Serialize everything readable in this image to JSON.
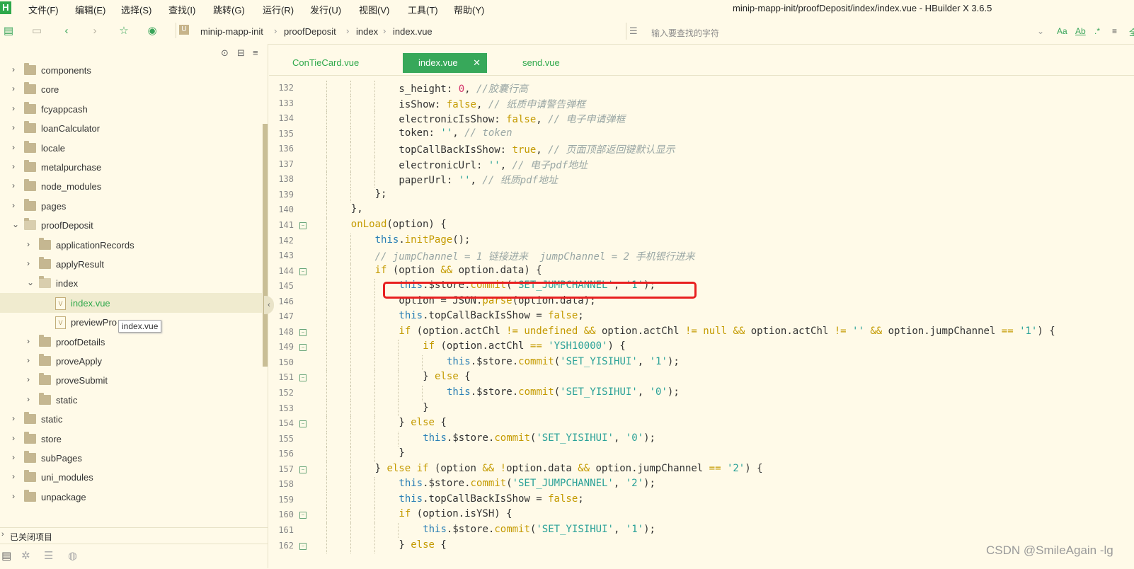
{
  "app": {
    "logo": "H",
    "window_title": "minip-mapp-init/proofDeposit/index/index.vue - HBuilder X 3.6.5",
    "menu": [
      "文件(F)",
      "编辑(E)",
      "选择(S)",
      "查找(I)",
      "跳转(G)",
      "运行(R)",
      "发行(U)",
      "视图(V)",
      "工具(T)",
      "帮助(Y)"
    ]
  },
  "toolbar": {
    "breadcrumb_icon": "U",
    "breadcrumb": [
      "minip-mapp-init",
      "proofDeposit",
      "index",
      "index.vue"
    ],
    "search_placeholder": "输入要查找的字符",
    "search_options": [
      "Aa",
      "Ab",
      ".*"
    ]
  },
  "sidebar": {
    "tree": [
      {
        "label": "components",
        "type": "folder",
        "depth": 0,
        "expanded": false
      },
      {
        "label": "core",
        "type": "folder",
        "depth": 0,
        "expanded": false
      },
      {
        "label": "fcyappcash",
        "type": "folder",
        "depth": 0,
        "expanded": false
      },
      {
        "label": "loanCalculator",
        "type": "folder",
        "depth": 0,
        "expanded": false
      },
      {
        "label": "locale",
        "type": "folder",
        "depth": 0,
        "expanded": false
      },
      {
        "label": "metalpurchase",
        "type": "folder",
        "depth": 0,
        "expanded": false
      },
      {
        "label": "node_modules",
        "type": "folder",
        "depth": 0,
        "expanded": false
      },
      {
        "label": "pages",
        "type": "folder",
        "depth": 0,
        "expanded": false
      },
      {
        "label": "proofDeposit",
        "type": "folder",
        "depth": 0,
        "expanded": true
      },
      {
        "label": "applicationRecords",
        "type": "folder",
        "depth": 1,
        "expanded": false
      },
      {
        "label": "applyResult",
        "type": "folder",
        "depth": 1,
        "expanded": false
      },
      {
        "label": "index",
        "type": "folder",
        "depth": 1,
        "expanded": true
      },
      {
        "label": "index.vue",
        "type": "file",
        "depth": 2,
        "selected": true
      },
      {
        "label": "previewPro",
        "type": "file",
        "depth": 2
      },
      {
        "label": "proofDetails",
        "type": "folder",
        "depth": 1,
        "expanded": false
      },
      {
        "label": "proveApply",
        "type": "folder",
        "depth": 1,
        "expanded": false
      },
      {
        "label": "proveSubmit",
        "type": "folder",
        "depth": 1,
        "expanded": false
      },
      {
        "label": "static",
        "type": "folder",
        "depth": 1,
        "expanded": false
      },
      {
        "label": "static",
        "type": "folder",
        "depth": 0,
        "expanded": false
      },
      {
        "label": "store",
        "type": "folder",
        "depth": 0,
        "expanded": false
      },
      {
        "label": "subPages",
        "type": "folder",
        "depth": 0,
        "expanded": false
      },
      {
        "label": "uni_modules",
        "type": "folder",
        "depth": 0,
        "expanded": false
      },
      {
        "label": "unpackage",
        "type": "folder",
        "depth": 0,
        "expanded": false
      }
    ],
    "tooltip": "index.vue",
    "closed_projects": "已关闭项目",
    "file_icon_letter": "V"
  },
  "editor": {
    "tabs": [
      {
        "label": "ConTieCard.vue",
        "active": false
      },
      {
        "label": "index.vue",
        "active": true
      },
      {
        "label": "send.vue",
        "active": false
      }
    ],
    "lines": [
      {
        "n": "132",
        "fold": false,
        "indent": 4,
        "segs": [
          [
            "",
            "s_height: "
          ],
          [
            "num",
            "0"
          ],
          [
            "",
            ", "
          ],
          [
            "cm",
            "//胶囊行高"
          ]
        ]
      },
      {
        "n": "133",
        "fold": false,
        "indent": 4,
        "segs": [
          [
            "",
            "isShow: "
          ],
          [
            "kw",
            "false"
          ],
          [
            "",
            ", "
          ],
          [
            "cm",
            "// 纸质申请警告弹框"
          ]
        ]
      },
      {
        "n": "134",
        "fold": false,
        "indent": 4,
        "segs": [
          [
            "",
            "electronicIsShow: "
          ],
          [
            "kw",
            "false"
          ],
          [
            "",
            ", "
          ],
          [
            "cm",
            "// 电子申请弹框"
          ]
        ]
      },
      {
        "n": "135",
        "fold": false,
        "indent": 4,
        "segs": [
          [
            "",
            "token: "
          ],
          [
            "str",
            "''"
          ],
          [
            "",
            ", "
          ],
          [
            "cm",
            "// token"
          ]
        ]
      },
      {
        "n": "136",
        "fold": false,
        "indent": 4,
        "segs": [
          [
            "",
            "topCallBackIsShow: "
          ],
          [
            "kw",
            "true"
          ],
          [
            "",
            ", "
          ],
          [
            "cm",
            "// 页面顶部返回键默认显示"
          ]
        ]
      },
      {
        "n": "137",
        "fold": false,
        "indent": 4,
        "segs": [
          [
            "",
            "electronicUrl: "
          ],
          [
            "str",
            "''"
          ],
          [
            "",
            ", "
          ],
          [
            "cm",
            "// 电子pdf地址"
          ]
        ]
      },
      {
        "n": "138",
        "fold": false,
        "indent": 4,
        "segs": [
          [
            "",
            "paperUrl: "
          ],
          [
            "str",
            "''"
          ],
          [
            "",
            ", "
          ],
          [
            "cm",
            "// 纸质pdf地址"
          ]
        ]
      },
      {
        "n": "139",
        "fold": false,
        "indent": 3,
        "segs": [
          [
            "",
            "};"
          ]
        ]
      },
      {
        "n": "140",
        "fold": false,
        "indent": 2,
        "segs": [
          [
            "",
            "},"
          ]
        ]
      },
      {
        "n": "141",
        "fold": true,
        "indent": 2,
        "segs": [
          [
            "fn",
            "onLoad"
          ],
          [
            "",
            "(option) {"
          ]
        ]
      },
      {
        "n": "142",
        "fold": false,
        "indent": 3,
        "segs": [
          [
            "this",
            "this"
          ],
          [
            "",
            "."
          ],
          [
            "fn",
            "initPage"
          ],
          [
            "",
            "();"
          ]
        ]
      },
      {
        "n": "143",
        "fold": false,
        "indent": 3,
        "segs": [
          [
            "cm",
            "// jumpChannel = 1 链接进来  jumpChannel = 2 手机银行进来"
          ]
        ]
      },
      {
        "n": "144",
        "fold": true,
        "indent": 3,
        "segs": [
          [
            "kw",
            "if"
          ],
          [
            "",
            " (option "
          ],
          [
            "kw",
            "&&"
          ],
          [
            "",
            " option.data) {"
          ]
        ]
      },
      {
        "n": "145",
        "fold": false,
        "indent": 4,
        "segs": [
          [
            "this",
            "this"
          ],
          [
            "",
            ".$store."
          ],
          [
            "fn",
            "commit"
          ],
          [
            "",
            "("
          ],
          [
            "str",
            "'SET_JUMPCHANNEL'"
          ],
          [
            "",
            ", "
          ],
          [
            "str",
            "'1'"
          ],
          [
            "",
            ");"
          ]
        ]
      },
      {
        "n": "146",
        "fold": false,
        "indent": 4,
        "segs": [
          [
            "",
            "option = JSON."
          ],
          [
            "fn",
            "parse"
          ],
          [
            "",
            "(option.data);"
          ]
        ]
      },
      {
        "n": "147",
        "fold": false,
        "indent": 4,
        "segs": [
          [
            "this",
            "this"
          ],
          [
            "",
            ".topCallBackIsShow = "
          ],
          [
            "kw",
            "false"
          ],
          [
            "",
            ";"
          ]
        ]
      },
      {
        "n": "148",
        "fold": true,
        "indent": 4,
        "segs": [
          [
            "kw",
            "if"
          ],
          [
            "",
            " (option.actChl "
          ],
          [
            "kw",
            "!="
          ],
          [
            "",
            " "
          ],
          [
            "kw",
            "undefined"
          ],
          [
            "",
            " "
          ],
          [
            "kw",
            "&&"
          ],
          [
            "",
            " option.actChl "
          ],
          [
            "kw",
            "!="
          ],
          [
            "",
            " "
          ],
          [
            "kw",
            "null"
          ],
          [
            "",
            " "
          ],
          [
            "kw",
            "&&"
          ],
          [
            "",
            " option.actChl "
          ],
          [
            "kw",
            "!="
          ],
          [
            "",
            " "
          ],
          [
            "str",
            "''"
          ],
          [
            "",
            " "
          ],
          [
            "kw",
            "&&"
          ],
          [
            "",
            " option.jumpChannel "
          ],
          [
            "kw",
            "=="
          ],
          [
            "",
            " "
          ],
          [
            "str",
            "'1'"
          ],
          [
            "",
            ") {"
          ]
        ]
      },
      {
        "n": "149",
        "fold": true,
        "indent": 5,
        "segs": [
          [
            "kw",
            "if"
          ],
          [
            "",
            " (option.actChl "
          ],
          [
            "kw",
            "=="
          ],
          [
            "",
            " "
          ],
          [
            "str",
            "'YSH10000'"
          ],
          [
            "",
            ") {"
          ]
        ]
      },
      {
        "n": "150",
        "fold": false,
        "indent": 6,
        "segs": [
          [
            "this",
            "this"
          ],
          [
            "",
            ".$store."
          ],
          [
            "fn",
            "commit"
          ],
          [
            "",
            "("
          ],
          [
            "str",
            "'SET_YISIHUI'"
          ],
          [
            "",
            ", "
          ],
          [
            "str",
            "'1'"
          ],
          [
            "",
            ");"
          ]
        ]
      },
      {
        "n": "151",
        "fold": true,
        "indent": 5,
        "segs": [
          [
            "",
            "} "
          ],
          [
            "kw",
            "else"
          ],
          [
            "",
            " {"
          ]
        ]
      },
      {
        "n": "152",
        "fold": false,
        "indent": 6,
        "segs": [
          [
            "this",
            "this"
          ],
          [
            "",
            ".$store."
          ],
          [
            "fn",
            "commit"
          ],
          [
            "",
            "("
          ],
          [
            "str",
            "'SET_YISIHUI'"
          ],
          [
            "",
            ", "
          ],
          [
            "str",
            "'0'"
          ],
          [
            "",
            ");"
          ]
        ]
      },
      {
        "n": "153",
        "fold": false,
        "indent": 5,
        "segs": [
          [
            "",
            "}"
          ]
        ]
      },
      {
        "n": "154",
        "fold": true,
        "indent": 4,
        "segs": [
          [
            "",
            "} "
          ],
          [
            "kw",
            "else"
          ],
          [
            "",
            " {"
          ]
        ]
      },
      {
        "n": "155",
        "fold": false,
        "indent": 5,
        "segs": [
          [
            "this",
            "this"
          ],
          [
            "",
            ".$store."
          ],
          [
            "fn",
            "commit"
          ],
          [
            "",
            "("
          ],
          [
            "str",
            "'SET_YISIHUI'"
          ],
          [
            "",
            ", "
          ],
          [
            "str",
            "'0'"
          ],
          [
            "",
            ");"
          ]
        ]
      },
      {
        "n": "156",
        "fold": false,
        "indent": 4,
        "segs": [
          [
            "",
            "}"
          ]
        ]
      },
      {
        "n": "157",
        "fold": true,
        "indent": 3,
        "segs": [
          [
            "",
            "} "
          ],
          [
            "kw",
            "else if"
          ],
          [
            "",
            " (option "
          ],
          [
            "kw",
            "&&"
          ],
          [
            "",
            " "
          ],
          [
            "kw",
            "!"
          ],
          [
            "",
            "option.data "
          ],
          [
            "kw",
            "&&"
          ],
          [
            "",
            " option.jumpChannel "
          ],
          [
            "kw",
            "=="
          ],
          [
            "",
            " "
          ],
          [
            "str",
            "'2'"
          ],
          [
            "",
            ") {"
          ]
        ]
      },
      {
        "n": "158",
        "fold": false,
        "indent": 4,
        "segs": [
          [
            "this",
            "this"
          ],
          [
            "",
            ".$store."
          ],
          [
            "fn",
            "commit"
          ],
          [
            "",
            "("
          ],
          [
            "str",
            "'SET_JUMPCHANNEL'"
          ],
          [
            "",
            ", "
          ],
          [
            "str",
            "'2'"
          ],
          [
            "",
            ");"
          ]
        ]
      },
      {
        "n": "159",
        "fold": false,
        "indent": 4,
        "segs": [
          [
            "this",
            "this"
          ],
          [
            "",
            ".topCallBackIsShow = "
          ],
          [
            "kw",
            "false"
          ],
          [
            "",
            ";"
          ]
        ]
      },
      {
        "n": "160",
        "fold": true,
        "indent": 4,
        "segs": [
          [
            "kw",
            "if"
          ],
          [
            "",
            " (option.isYSH) {"
          ]
        ]
      },
      {
        "n": "161",
        "fold": false,
        "indent": 5,
        "segs": [
          [
            "this",
            "this"
          ],
          [
            "",
            ".$store."
          ],
          [
            "fn",
            "commit"
          ],
          [
            "",
            "("
          ],
          [
            "str",
            "'SET_YISIHUI'"
          ],
          [
            "",
            ", "
          ],
          [
            "str",
            "'1'"
          ],
          [
            "",
            ");"
          ]
        ]
      },
      {
        "n": "162",
        "fold": true,
        "indent": 4,
        "segs": [
          [
            "",
            "} "
          ],
          [
            "kw",
            "else"
          ],
          [
            "",
            " {"
          ]
        ]
      }
    ]
  },
  "watermark": "CSDN @SmileAgain -lg",
  "colors": {
    "accent": "#37a85a",
    "highlight_border": "#e82020",
    "background": "#fffae8"
  }
}
